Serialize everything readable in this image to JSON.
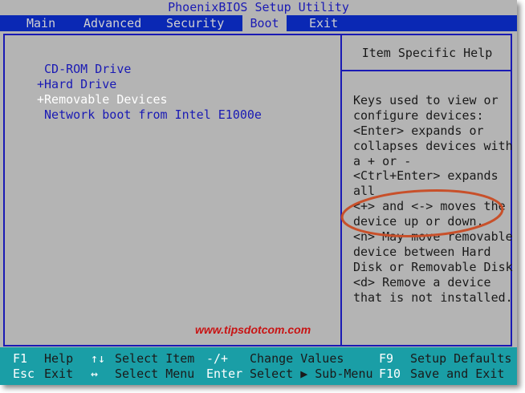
{
  "title": "PhoenixBIOS Setup Utility",
  "menu": {
    "main": "Main",
    "advanced": "Advanced",
    "security": "Security",
    "boot": "Boot",
    "exit": "Exit"
  },
  "boot_list": [
    " CD-ROM Drive",
    "+Hard Drive",
    "+Removable Devices",
    " Network boot from Intel E1000e"
  ],
  "help": {
    "title": "Item Specific Help",
    "lines": [
      "Keys used to view or",
      "configure devices:",
      "<Enter> expands or",
      "collapses devices with",
      "a + or -",
      "<Ctrl+Enter> expands",
      "all",
      "<+> and <-> moves the",
      "device up or down.",
      "<n> May move removable",
      "device between Hard",
      "Disk or Removable Disk",
      "<d> Remove a device",
      "that is not installed."
    ]
  },
  "watermark": "www.tipsdotcom.com",
  "footer": {
    "row1": {
      "k1": "F1",
      "d1": "Help",
      "k2": "↑↓",
      "d2": "Select Item",
      "k3": "-/+",
      "d3": "Change Values",
      "k4": "F9",
      "d4": "Setup Defaults"
    },
    "row2": {
      "k1": "Esc",
      "d1": "Exit",
      "k2": "↔",
      "d2": "Select Menu",
      "k3": "Enter",
      "d3": "Select ▶ Sub-Menu",
      "k4": "F10",
      "d4": "Save and Exit"
    }
  },
  "colors": {
    "background": "#b4b4b4",
    "menubar": "#0a28b4",
    "accent_text": "#1a1ab4",
    "footer": "#1a9ea6",
    "annotation": "#c8502a"
  }
}
